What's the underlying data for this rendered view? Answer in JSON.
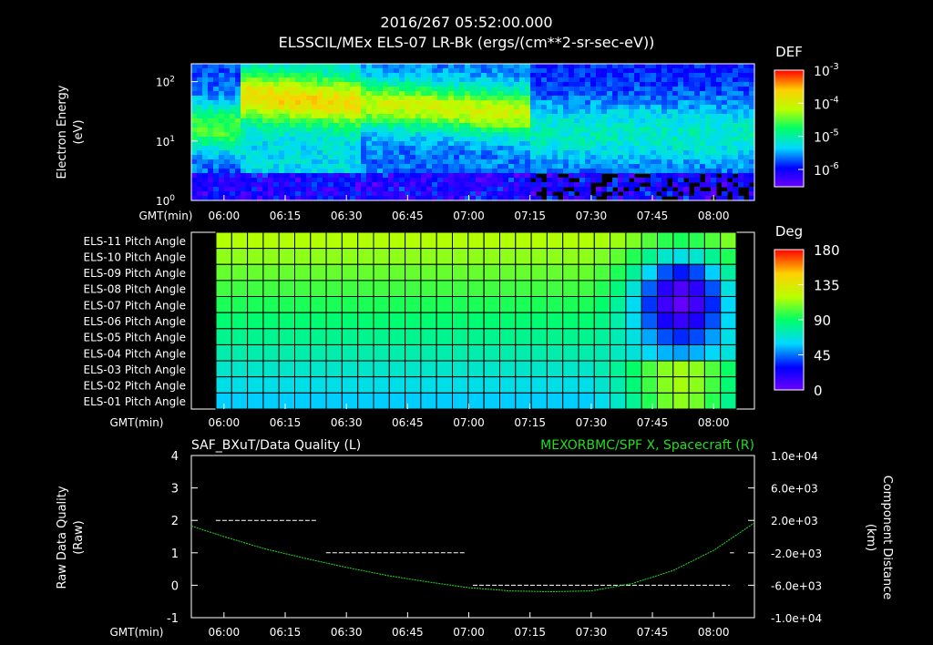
{
  "header": {
    "date_time": "2016/267 05:52:00.000",
    "title": "ELSSCIL/MEx ELS-07 LR-Bk  (ergs/(cm**2-sr-sec-eV))"
  },
  "colors": {
    "background": "#000000",
    "foreground": "#ffffff",
    "right_series": "#22dd22"
  },
  "time_axis": {
    "label": "GMT(min)",
    "ticks": [
      "06:00",
      "06:15",
      "06:30",
      "06:45",
      "07:00",
      "07:15",
      "07:30",
      "07:45",
      "08:00"
    ]
  },
  "chart_data": [
    {
      "type": "heatmap",
      "title": "ELSSCIL/MEx ELS-07 LR-Bk  (ergs/(cm**2-sr-sec-eV))",
      "ylabel": "Electron Energy (eV)",
      "ylabel_lines": [
        "Electron Energy",
        "(eV)"
      ],
      "xlabel": "GMT(min)",
      "y_scale": "log",
      "ylim": [
        1,
        200
      ],
      "y_ticks": [
        {
          "base": "10",
          "exp": "0",
          "value": 1
        },
        {
          "base": "10",
          "exp": "1",
          "value": 10
        },
        {
          "base": "10",
          "exp": "2",
          "value": 100
        }
      ],
      "x_range": [
        "05:52",
        "08:10"
      ],
      "colorbar": {
        "title": "DEF",
        "scale": "log",
        "range": [
          3e-07,
          0.001
        ],
        "ticks": [
          {
            "base": "10",
            "exp": "-3",
            "value": 0.001
          },
          {
            "base": "10",
            "exp": "-4",
            "value": 0.0001
          },
          {
            "base": "10",
            "exp": "-5",
            "value": 1e-05
          },
          {
            "base": "10",
            "exp": "-6",
            "value": 1e-06
          }
        ]
      }
    },
    {
      "type": "heatmap",
      "xlabel": "GMT(min)",
      "row_labels": [
        "ELS-11 Pitch Angle",
        "ELS-10 Pitch Angle",
        "ELS-09 Pitch Angle",
        "ELS-08 Pitch Angle",
        "ELS-07 Pitch Angle",
        "ELS-06 Pitch Angle",
        "ELS-05 Pitch Angle",
        "ELS-04 Pitch Angle",
        "ELS-03 Pitch Angle",
        "ELS-02 Pitch Angle",
        "ELS-01 Pitch Angle"
      ],
      "x_range": [
        "05:52",
        "08:10"
      ],
      "colorbar": {
        "title": "Deg",
        "range": [
          0,
          180
        ],
        "ticks": [
          "180",
          "135",
          "90",
          "45",
          "0"
        ]
      }
    },
    {
      "type": "line",
      "left_title": "SAF_BXuT/Data Quality (L)",
      "right_title": "MEXORBMC/SPF X, Spacecraft (R)",
      "ylabel_left": "Raw Data Quality (Raw)",
      "ylabel_left_lines": [
        "Raw Data Quality",
        "(Raw)"
      ],
      "ylabel_right": "Component Distance (km)",
      "ylabel_right_lines": [
        "Component Distance",
        "(km)"
      ],
      "xlabel": "GMT(min)",
      "ylim_left": [
        -1,
        4
      ],
      "y_ticks_left": [
        "4",
        "3",
        "2",
        "1",
        "0",
        "-1"
      ],
      "ylim_right": [
        -10000,
        10000
      ],
      "y_ticks_right": [
        "1.0e+04",
        "6.0e+03",
        "2.0e+03",
        "-2.0e+03",
        "-6.0e+03",
        "-1.0e+04"
      ],
      "series": [
        {
          "name": "SAF_BXuT/Data Quality",
          "axis": "left",
          "style": "dashed-segments",
          "segments": [
            {
              "x": [
                "05:58",
                "06:23"
              ],
              "y": 2
            },
            {
              "x": [
                "06:25",
                "06:59"
              ],
              "y": 1
            },
            {
              "x": [
                "07:01",
                "08:04"
              ],
              "y": 0
            },
            {
              "x": [
                "08:04",
                "08:05"
              ],
              "y": 1
            }
          ]
        },
        {
          "name": "MEXORBMC/SPF X, Spacecraft",
          "axis": "right",
          "x": [
            "05:52",
            "06:00",
            "06:10",
            "06:20",
            "06:30",
            "06:40",
            "06:50",
            "07:00",
            "07:10",
            "07:20",
            "07:30",
            "07:40",
            "07:50",
            "08:00",
            "08:10"
          ],
          "y": [
            1300,
            0,
            -1500,
            -2700,
            -3800,
            -4800,
            -5600,
            -6300,
            -6700,
            -6800,
            -6700,
            -5800,
            -4200,
            -1700,
            1700
          ]
        }
      ]
    }
  ]
}
